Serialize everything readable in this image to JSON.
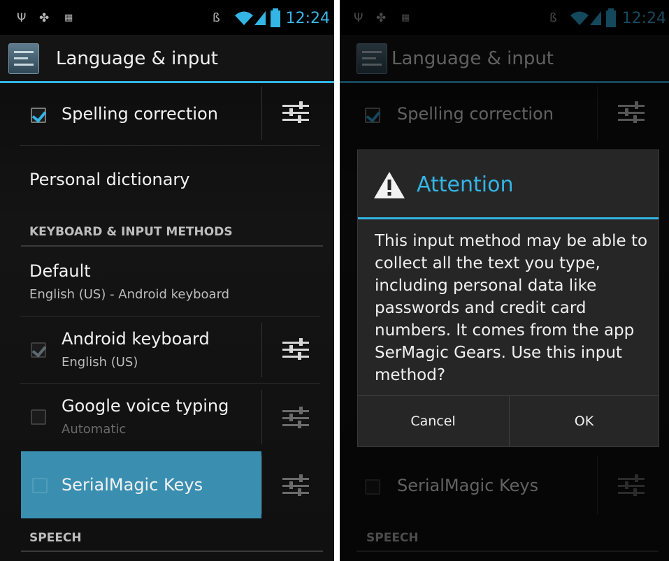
{
  "status_bar": {
    "time": "12:24",
    "left_icons": [
      "usb-icon",
      "android-debug-icon",
      "image-notification-icon"
    ],
    "right_icons": [
      "bluetooth-icon",
      "wifi-icon",
      "signal-icon",
      "battery-icon"
    ]
  },
  "action_bar": {
    "title": "Language & input",
    "icon": "settings-app-icon"
  },
  "settings": {
    "spelling_correction": {
      "label": "Spelling correction",
      "checked": true
    },
    "personal_dictionary": {
      "label": "Personal dictionary"
    },
    "keyboard_section": {
      "header": "KEYBOARD & INPUT METHODS"
    },
    "default": {
      "title": "Default",
      "summary": "English (US) - Android keyboard"
    },
    "android_keyboard": {
      "title": "Android keyboard",
      "summary": "English (US)",
      "checked": true,
      "enabled": false
    },
    "google_voice": {
      "title": "Google voice typing",
      "summary": "Automatic",
      "checked": false
    },
    "serialmagic": {
      "title": "SerialMagic Keys",
      "checked": false,
      "pressed": true
    },
    "speech_section": {
      "header": "SPEECH"
    }
  },
  "dialog": {
    "title": "Attention",
    "icon": "warning-icon",
    "message": "This input method may be able to collect all the text you type, including personal data like passwords and credit card numbers. It comes from the app SerMagic Gears. Use this input method?",
    "cancel_label": "Cancel",
    "ok_label": "OK"
  },
  "colors": {
    "accent": "#33b5e5",
    "pressed_row": "#3a8fb1",
    "background": "#111111"
  }
}
